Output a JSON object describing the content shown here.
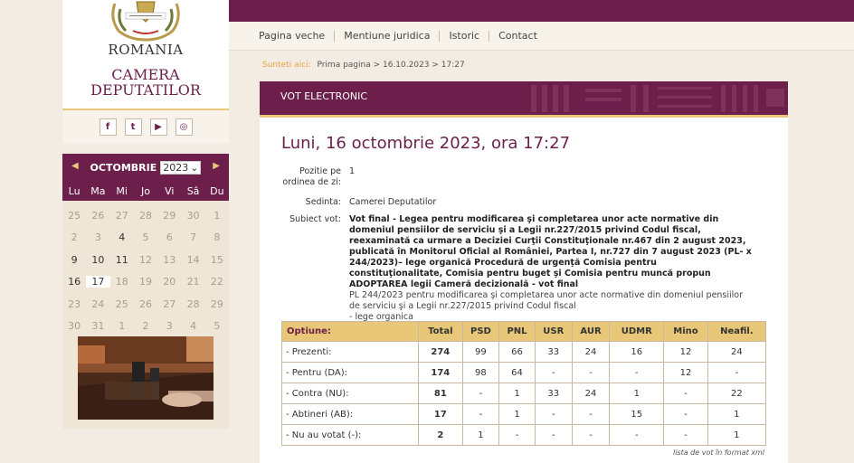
{
  "logo": {
    "country": "ROMANIA",
    "institution_line1": "CAMERA",
    "institution_line2": "DEPUTATILOR"
  },
  "social": [
    {
      "name": "facebook-icon",
      "glyph": "f"
    },
    {
      "name": "twitter-icon",
      "glyph": "t"
    },
    {
      "name": "youtube-icon",
      "glyph": "▶"
    },
    {
      "name": "instagram-icon",
      "glyph": "◎"
    }
  ],
  "nav": {
    "items": [
      "Pagina veche",
      "Mentiune juridica",
      "Istoric",
      "Contact"
    ]
  },
  "breadcrumb": {
    "prefix": "Sunteti aici:",
    "path": "Prima pagina > 16.10.2023 > 17:27"
  },
  "calendar": {
    "month": "OCTOMBRIE",
    "year": "2023",
    "weekdays": [
      "Lu",
      "Ma",
      "Mi",
      "Jo",
      "Vi",
      "Sâ",
      "Du"
    ],
    "weeks": [
      [
        [
          "25",
          "m"
        ],
        [
          "26",
          "m"
        ],
        [
          "27",
          "m"
        ],
        [
          "28",
          "m"
        ],
        [
          "29",
          "m"
        ],
        [
          "30",
          "m"
        ],
        [
          "1",
          "m"
        ]
      ],
      [
        [
          "2",
          "m"
        ],
        [
          "3",
          "m"
        ],
        [
          "4",
          ""
        ],
        [
          "5",
          "m"
        ],
        [
          "6",
          "m"
        ],
        [
          "7",
          "m"
        ],
        [
          "8",
          "m"
        ]
      ],
      [
        [
          "9",
          ""
        ],
        [
          "10",
          ""
        ],
        [
          "11",
          ""
        ],
        [
          "12",
          "m"
        ],
        [
          "13",
          "m"
        ],
        [
          "14",
          "m"
        ],
        [
          "15",
          "m"
        ]
      ],
      [
        [
          "16",
          ""
        ],
        [
          "17",
          "t"
        ],
        [
          "18",
          "m"
        ],
        [
          "19",
          "m"
        ],
        [
          "20",
          "m"
        ],
        [
          "21",
          "m"
        ],
        [
          "22",
          "m"
        ]
      ],
      [
        [
          "23",
          "m"
        ],
        [
          "24",
          "m"
        ],
        [
          "25",
          "m"
        ],
        [
          "26",
          "m"
        ],
        [
          "27",
          "m"
        ],
        [
          "28",
          "m"
        ],
        [
          "29",
          "m"
        ]
      ],
      [
        [
          "30",
          "m"
        ],
        [
          "31",
          "m"
        ],
        [
          "1",
          "m"
        ],
        [
          "2",
          "m"
        ],
        [
          "3",
          "m"
        ],
        [
          "4",
          "m"
        ],
        [
          "5",
          "m"
        ]
      ]
    ]
  },
  "panel": {
    "header": "VOT ELECTRONIC",
    "title": "Luni, 16 octombrie 2023, ora 17:27",
    "pozitie_label": "Pozitie pe ordinea de zi:",
    "pozitie_value": "1",
    "sedinta_label": "Sedinta:",
    "sedinta_value": "Camerei Deputatilor",
    "subiect_label": "Subiect vot:",
    "subiect_title": "Vot final - Legea pentru modificarea şi completarea unor acte normative din domeniul pensiilor de serviciu şi a Legii nr.227/2015 privind Codul fiscal, reexaminată ca urmare a Deciziei Curţii Constituţionale nr.467 din 2 august 2023, publicată în Monitorul Oficial al României, Partea I, nr.727 din 7 august 2023 (PL- x 244/2023)– lege organică Procedură de urgenţă Comisia pentru constituţionalitate, Comisia pentru buget şi Comisia pentru muncă propun ADOPTAREA legii Cameră decizională - vot final",
    "subiect_desc": "PL 244/2023 pentru modificarea şi completarea unor acte normative din domeniul pensiilor de serviciu şi a Legii nr.227/2015 privind Codul fiscal",
    "subiect_type": "- lege organica",
    "xml_link": "lista de vot în format xml"
  },
  "votes": {
    "headers": [
      "Optiune:",
      "Total",
      "PSD",
      "PNL",
      "USR",
      "AUR",
      "UDMR",
      "Mino",
      "Neafil."
    ],
    "rows": [
      [
        "- Prezenti:",
        "274",
        "99",
        "66",
        "33",
        "24",
        "16",
        "12",
        "24"
      ],
      [
        "- Pentru (DA):",
        "174",
        "98",
        "64",
        "-",
        "-",
        "-",
        "12",
        "-"
      ],
      [
        "- Contra (NU):",
        "81",
        "-",
        "1",
        "33",
        "24",
        "1",
        "-",
        "22"
      ],
      [
        "- Abtineri (AB):",
        "17",
        "-",
        "1",
        "-",
        "-",
        "15",
        "-",
        "1"
      ],
      [
        "- Nu au votat (-):",
        "2",
        "1",
        "-",
        "-",
        "-",
        "-",
        "-",
        "1"
      ]
    ]
  }
}
